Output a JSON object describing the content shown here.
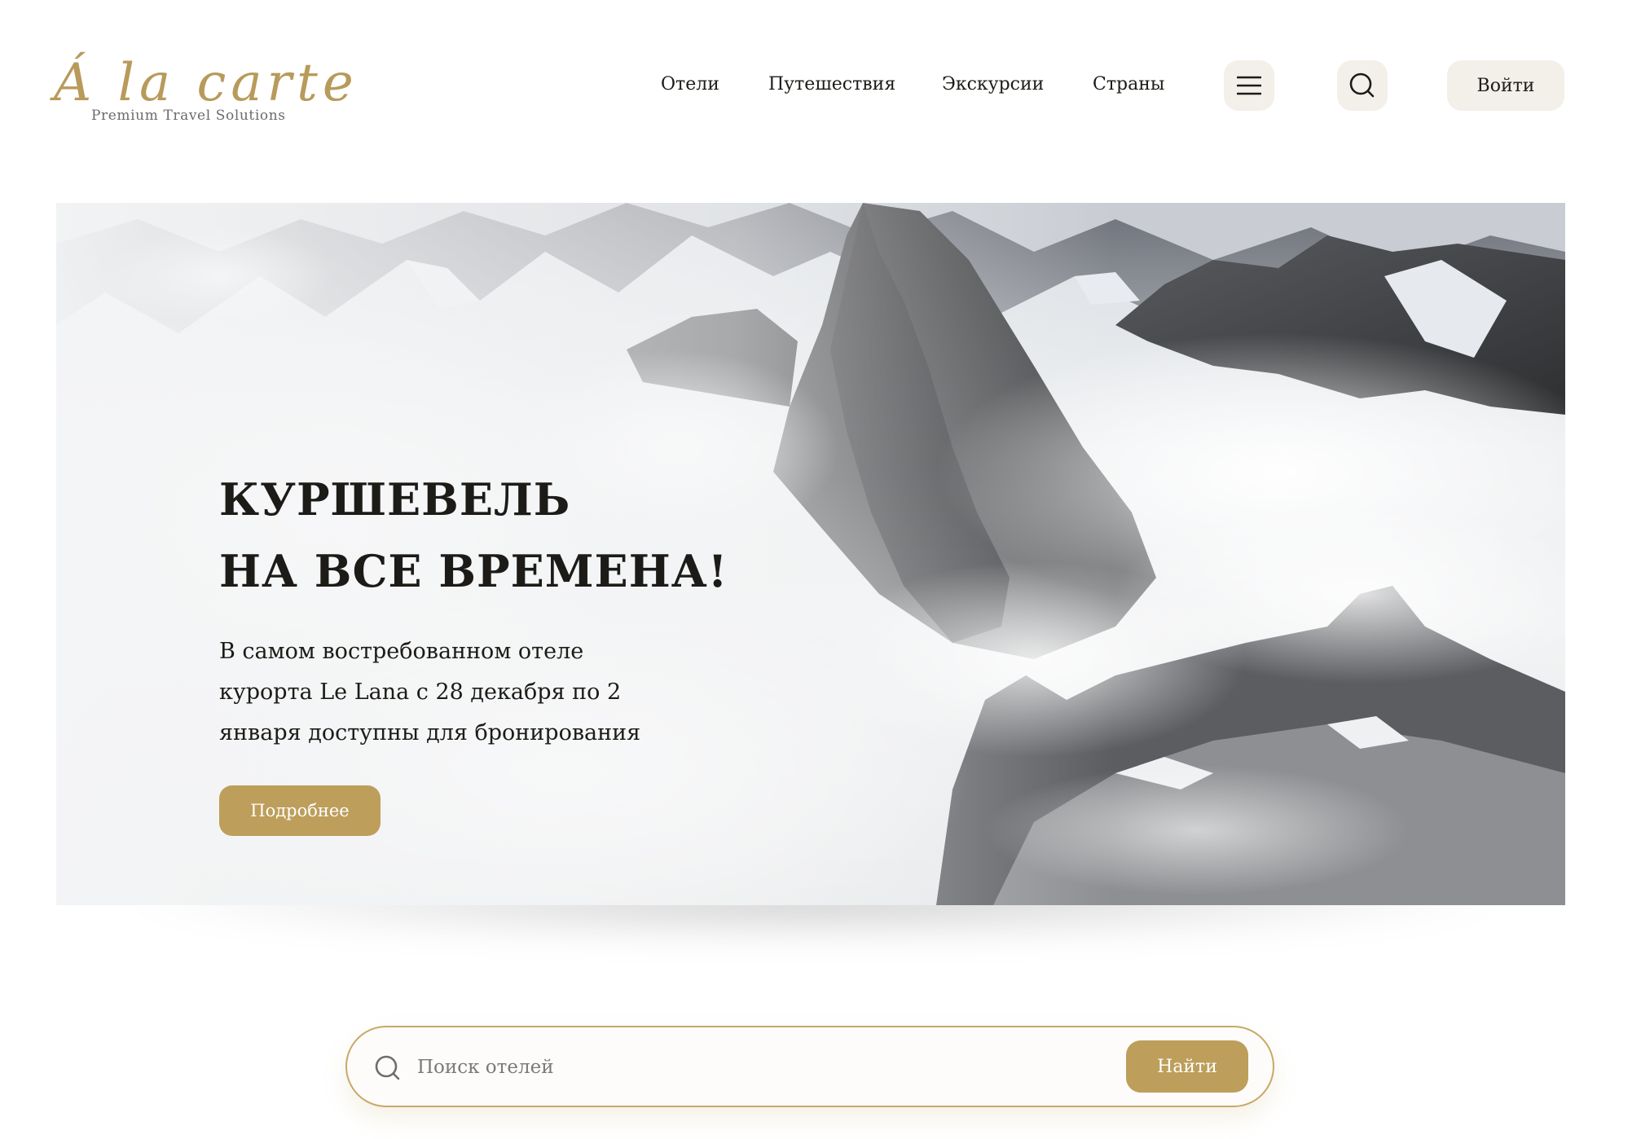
{
  "brand": {
    "logo_text": "Á la carte",
    "tagline": "Premium Travel Solutions"
  },
  "nav": {
    "items": [
      {
        "label": "Отели"
      },
      {
        "label": "Путешествия"
      },
      {
        "label": "Экскурсии"
      },
      {
        "label": "Страны"
      }
    ],
    "menu_icon": "hamburger-menu-icon",
    "search_icon": "search-icon",
    "login_label": "Войти"
  },
  "hero": {
    "title_line1": "КУРШЕВЕЛЬ",
    "title_line2": "НА ВСЕ ВРЕМЕНА!",
    "description": "В самом востребованном отеле курорта Le Lana с 28 декабря по 2 января доступны для бронирования",
    "button_label": "Подробнее"
  },
  "search": {
    "placeholder": "Поиск отелей",
    "value": "",
    "button_label": "Найти",
    "icon": "search-icon"
  },
  "colors": {
    "accent": "#bd9e5a",
    "button_bg": "#f3f0e9",
    "text": "#1c1b17"
  }
}
